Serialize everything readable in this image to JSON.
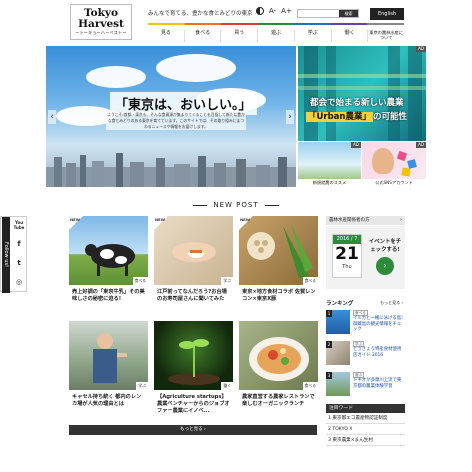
{
  "header": {
    "logo": {
      "line1": "Tokyo",
      "line2": "Harvest",
      "line3": "ートーキョーハーベストー"
    },
    "tagline": "みんなで育てる、豊かな食とみどりの東京",
    "font_controls": {
      "a_minus": "A-",
      "a_plus": "A+"
    },
    "search": {
      "button": "検索"
    },
    "english_button": "English",
    "colorbar": [
      "#f2c300",
      "#e8731c",
      "#d93b3b",
      "#2b8a3e",
      "#1b74c4",
      "#6b3fa0",
      "#888888"
    ],
    "nav": [
      "見る",
      "食べる",
      "買う",
      "遊ぶ",
      "学ぶ",
      "働く",
      "東京の農林水産について"
    ]
  },
  "hero": {
    "title": "「東京は、おいしい。」",
    "body": "ようこそ!首都・東京も、そんな食資源が集まりてくることを目指して新たな豊かな食とみどりのある東京を育てています。このサイトでは、その取り組みにまつわるニュースや情報をお届けします。",
    "prev": "‹",
    "next": "›"
  },
  "side": {
    "banner1": {
      "line1": "都会で始まる新しい農業",
      "line2_hl": "「Urban農業」",
      "line2_rest": "の可能性",
      "ad": "AD"
    },
    "banner2": {
      "caption": "新規就農のススメ",
      "ad": "AD"
    },
    "banner3": {
      "caption": "公式SNSアカウント",
      "ad": "AD"
    }
  },
  "new_post": {
    "heading": "NEW POST",
    "cards": [
      {
        "badge": "NEW",
        "category": "食べる",
        "caption": "売上好調の「東京牛乳」その美味しさの秘密に迫る!"
      },
      {
        "badge": "NEW",
        "category": "学ぶ",
        "caption": "江戸前ってなんだろう?お台場のお寿司屋さんに聞いてみた"
      },
      {
        "badge": "NEW",
        "category": "食べる",
        "caption": "東京×地方食材コラボ 佐賀レンコン×東京X豚"
      },
      {
        "badge": "",
        "category": "学ぶ",
        "caption": "キャセル持ち統く 都内のレンカ場が人気の理由とは"
      },
      {
        "badge": "",
        "category": "働く",
        "caption": "【Agriculture startups】農業ベンチャーからのジョブオファー農業にイノベ..."
      },
      {
        "badge": "",
        "category": "食べる",
        "caption": "農家直営する農家レストランで楽しむオーガニックランチ"
      }
    ],
    "more_button": "もっと見る ›"
  },
  "follow": {
    "label": "Follow us!",
    "icons": [
      "You Tube",
      "f",
      "t",
      "◎"
    ]
  },
  "right": {
    "notice_head": "農林水産関係者の方",
    "calendar": {
      "date_top": "2016 / 7",
      "day": "21",
      "dow": "Thu",
      "text": "イベントをチェックする!",
      "button": "›"
    },
    "ranking_head": "ランキング",
    "ranking_more": "もっと見る ›",
    "ranking": [
      {
        "num": "1",
        "cat": "食べる",
        "title": "イルカと一緒に泳げる島!御蔵島の観光情報をチェック"
      },
      {
        "num": "2",
        "cat": "学ぶ",
        "title": "とうきょう特産食材使用店ガイド 2016"
      },
      {
        "num": "3",
        "cat": "遊ぶ",
        "title": "トキオが多摩川上流で東京都の農業体験学習"
      }
    ],
    "words_head": "注目ワード",
    "words_more": "もっと見る ›",
    "words": [
      "1 東京都エコ農産物認証制度",
      "2 TOKYO X",
      "3 東京農業×まん生村"
    ]
  }
}
